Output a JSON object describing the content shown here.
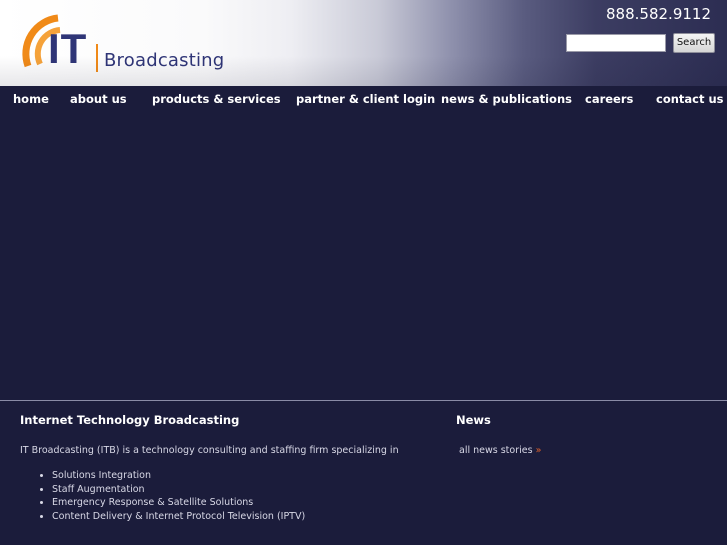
{
  "header": {
    "logo_initials": "IT",
    "logo_wordmark": "Broadcasting",
    "phone": "888.582.9112",
    "search": {
      "value": "",
      "placeholder": "",
      "button_label": "Search"
    }
  },
  "nav": {
    "items": [
      {
        "label": "home"
      },
      {
        "label": "about us"
      },
      {
        "label": "products & services"
      },
      {
        "label": "partner & client login"
      },
      {
        "label": "news & publications"
      },
      {
        "label": "careers"
      },
      {
        "label": "contact us"
      }
    ]
  },
  "intro": {
    "title": "Internet Technology Broadcasting",
    "text": "IT Broadcasting (ITB) is a technology consulting and staffing firm specializing in",
    "services": [
      "Solutions Integration",
      "Staff Augmentation",
      "Emergency Response & Satellite Solutions",
      "Content Delivery & Internet Protocol Television (IPTV)"
    ]
  },
  "news": {
    "title": "News",
    "link_label": "all news stories",
    "link_arrow": "»"
  },
  "colors": {
    "background": "#1b1c3b",
    "logo_orange": "#f08a18",
    "logo_navy": "#2f3577",
    "link_arrow": "#e0622a"
  }
}
